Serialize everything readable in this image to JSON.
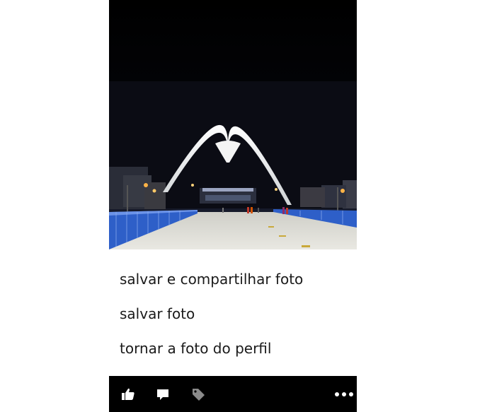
{
  "photo": {
    "subject": "night-stadium-arch"
  },
  "menu": {
    "items": [
      {
        "label": "salvar e compartilhar foto"
      },
      {
        "label": "salvar foto"
      },
      {
        "label": "tornar a foto do perfil"
      }
    ]
  },
  "appbar": {
    "background": "#000000",
    "icon_color": "#ffffff",
    "disabled_icon_color": "#8a8a8a",
    "icons": [
      "like-icon",
      "comment-icon",
      "tag-icon",
      "more-icon"
    ]
  }
}
